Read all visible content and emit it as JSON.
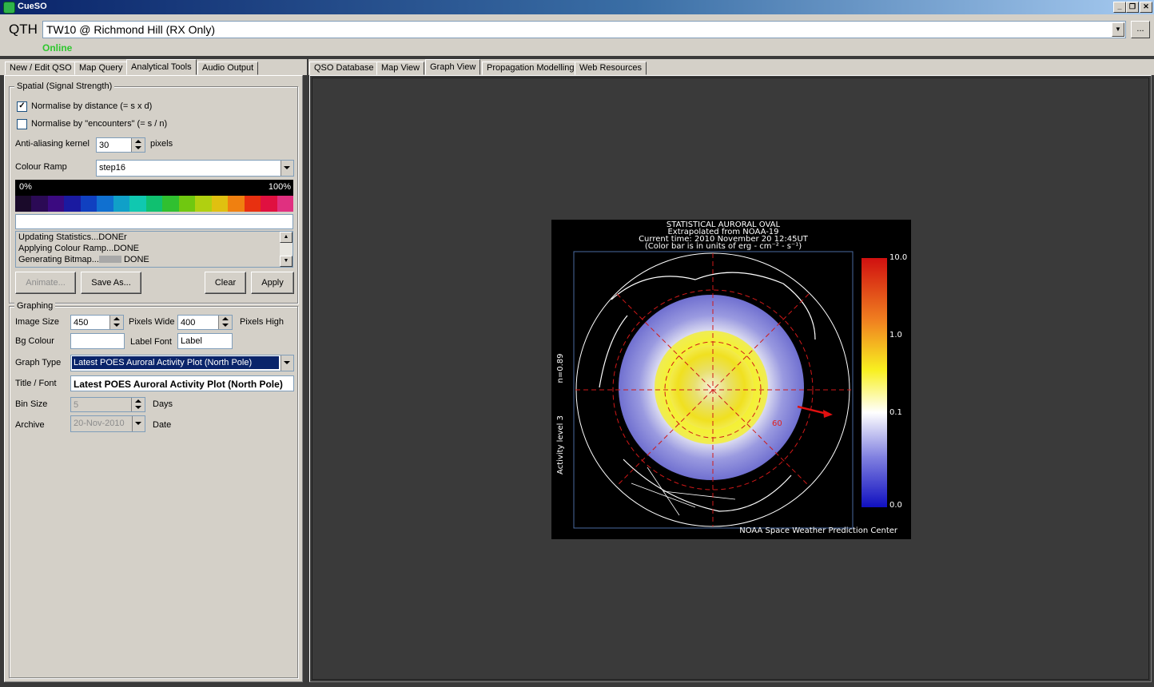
{
  "app": {
    "title": "CueSO"
  },
  "qth": {
    "label": "QTH",
    "value": "TW10 @ Richmond Hill (RX Only)",
    "more": "...",
    "status": "Online",
    "status_color": "#2ec72e"
  },
  "left_tabs": [
    "New / Edit QSO",
    "Map Query",
    "Analytical Tools",
    "Audio Output"
  ],
  "left_active_tab": "Analytical Tools",
  "right_tabs": [
    "QSO Database",
    "Map View",
    "Graph View",
    "Propagation Modelling",
    "Web Resources"
  ],
  "right_active_tab": "Graph View",
  "spatial": {
    "title": "Spatial (Signal Strength)",
    "normalise_distance": {
      "label": "Normalise by distance (= s x d)",
      "checked": true
    },
    "normalise_encounters": {
      "label": "Normalise by \"encounters\" (= s / n)",
      "checked": false
    },
    "kernel_label": "Anti-aliasing kernel",
    "kernel_value": "30",
    "kernel_unit": "pixels",
    "ramp_label": "Colour Ramp",
    "ramp_value": "step16",
    "ramp_min": "0%",
    "ramp_max": "100%",
    "ramp_colors": [
      "#1a0a2a",
      "#2b0a55",
      "#3b0a80",
      "#1a1aa0",
      "#1040c0",
      "#1070d0",
      "#10a0c8",
      "#10c8b0",
      "#10c070",
      "#30c030",
      "#70c810",
      "#b0d010",
      "#e0c010",
      "#f08010",
      "#e83010",
      "#e01040",
      "#e03080"
    ],
    "log": [
      "Updating Statistics...DONEr",
      "Applying Colour Ramp...DONE",
      "Generating Bitmap...",
      "DONE"
    ],
    "buttons": {
      "animate": "Animate...",
      "save_as": "Save As...",
      "clear": "Clear",
      "apply": "Apply"
    }
  },
  "graphing": {
    "title": "Graphing",
    "image_size_label": "Image Size",
    "width_value": "450",
    "width_unit": "Pixels Wide",
    "height_value": "400",
    "height_unit": "Pixels High",
    "bg_label": "Bg Colour",
    "label_font_label": "Label Font",
    "label_font_value": "Label",
    "graph_type_label": "Graph Type",
    "graph_type_value": "Latest POES Auroral Activity Plot (North Pole)",
    "title_font_label": "Title / Font",
    "title_font_value": "Latest POES Auroral Activity Plot (North Pole)",
    "bin_label": "Bin Size",
    "bin_value": "5",
    "bin_unit": "Days",
    "archive_label": "Archive",
    "archive_value": "20-Nov-2010",
    "archive_unit": "Date"
  },
  "plot": {
    "title_lines": [
      "STATISTICAL AURORAL OVAL",
      "Extrapolated from NOAA-19",
      "Current time: 2010 November 20 12:45UT",
      "(Color bar is in units of erg - cm⁻² - s⁻¹)"
    ],
    "side_label_1": "n=0.89",
    "side_label_2": "Activity level 3",
    "latitude_label": "60",
    "colorbar_ticks": [
      "10.0",
      "1.0",
      "0.1",
      "0.0"
    ],
    "credit": "NOAA Space Weather Prediction Center"
  }
}
